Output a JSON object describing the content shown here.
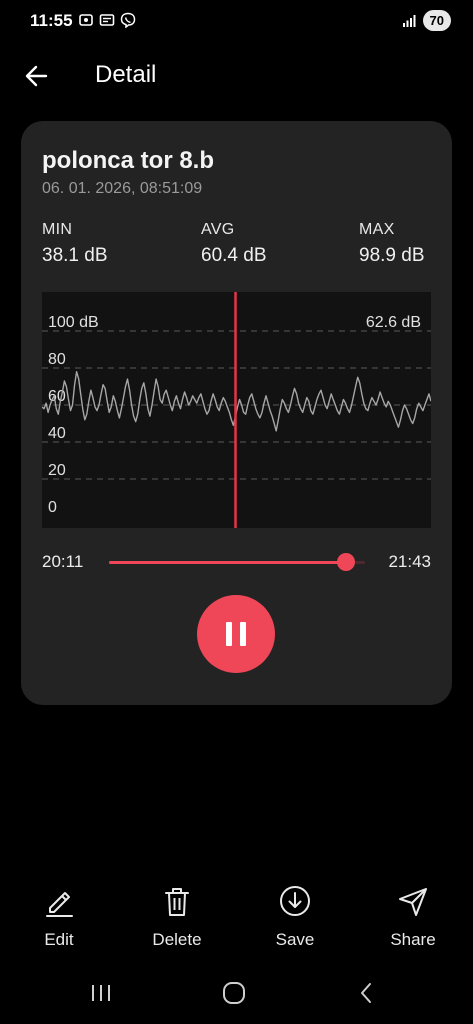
{
  "status_bar": {
    "time": "11:55",
    "battery": "70"
  },
  "app_bar": {
    "title": "Detail",
    "back_icon": "arrow-left-icon"
  },
  "recording": {
    "name": "polonca tor 8.b",
    "datetime": "06. 01. 2026, 08:51:09",
    "min_label": "MIN",
    "min_value": "38.1 dB",
    "avg_label": "AVG",
    "avg_value": "60.4 dB",
    "max_label": "MAX",
    "max_value": "98.9 dB"
  },
  "chart_data": {
    "type": "line",
    "ylim": [
      0,
      100
    ],
    "y_ticks": [
      "100 dB",
      "80",
      "60",
      "40",
      "20",
      "0"
    ],
    "cursor_readout": "62.6 dB",
    "cursor_position_fraction": 0.5,
    "series": [
      {
        "values": [
          59,
          58,
          61,
          56,
          60,
          63,
          65,
          58,
          55,
          62,
          67,
          73,
          70,
          63,
          57,
          60,
          71,
          78,
          74,
          66,
          58,
          52,
          55,
          62,
          68,
          64,
          59,
          57,
          60,
          66,
          71,
          69,
          62,
          56,
          59,
          65,
          62,
          57,
          53,
          58,
          64,
          70,
          74,
          68,
          60,
          54,
          51,
          55,
          63,
          69,
          72,
          66,
          58,
          54,
          60,
          67,
          74,
          70,
          63,
          61,
          66,
          68,
          64,
          60,
          57,
          62,
          65,
          61,
          58,
          63,
          67,
          64,
          60,
          62,
          65,
          63,
          61,
          64,
          66,
          62,
          58,
          55,
          57,
          62,
          66,
          63,
          59,
          57,
          61,
          64,
          62,
          59,
          56,
          52,
          49,
          54,
          59,
          63,
          60,
          56,
          55,
          60,
          64,
          66,
          62,
          58,
          55,
          53,
          56,
          61,
          65,
          61,
          57,
          54,
          50,
          46,
          52,
          58,
          63,
          61,
          58,
          56,
          60,
          65,
          69,
          66,
          61,
          58,
          56,
          60,
          64,
          62,
          57,
          55,
          59,
          63,
          66,
          68,
          64,
          60,
          58,
          62,
          66,
          63,
          60,
          57,
          55,
          59,
          63,
          61,
          58,
          56,
          60,
          65,
          70,
          75,
          72,
          66,
          61,
          58,
          57,
          61,
          64,
          62,
          60,
          63,
          67,
          64,
          61,
          59,
          62,
          60,
          57,
          54,
          51,
          48,
          52,
          57,
          60,
          58,
          55,
          52,
          50,
          53,
          58,
          61,
          59,
          57,
          60,
          63,
          66,
          62
        ]
      }
    ],
    "line_color": "#a6a6a6",
    "cursor_color": "#e8344a"
  },
  "player": {
    "time_start": "20:11",
    "time_end": "21:43",
    "progress": 0.925,
    "accent": "#ef4758",
    "state_icon": "pause-icon"
  },
  "actions": {
    "edit": {
      "label": "Edit",
      "icon": "pencil-icon"
    },
    "delete": {
      "label": "Delete",
      "icon": "trash-icon"
    },
    "save": {
      "label": "Save",
      "icon": "download-icon"
    },
    "share": {
      "label": "Share",
      "icon": "send-icon"
    }
  },
  "nav": {
    "recents_icon": "recents-icon",
    "home_icon": "home-icon",
    "back_icon": "back-icon"
  }
}
